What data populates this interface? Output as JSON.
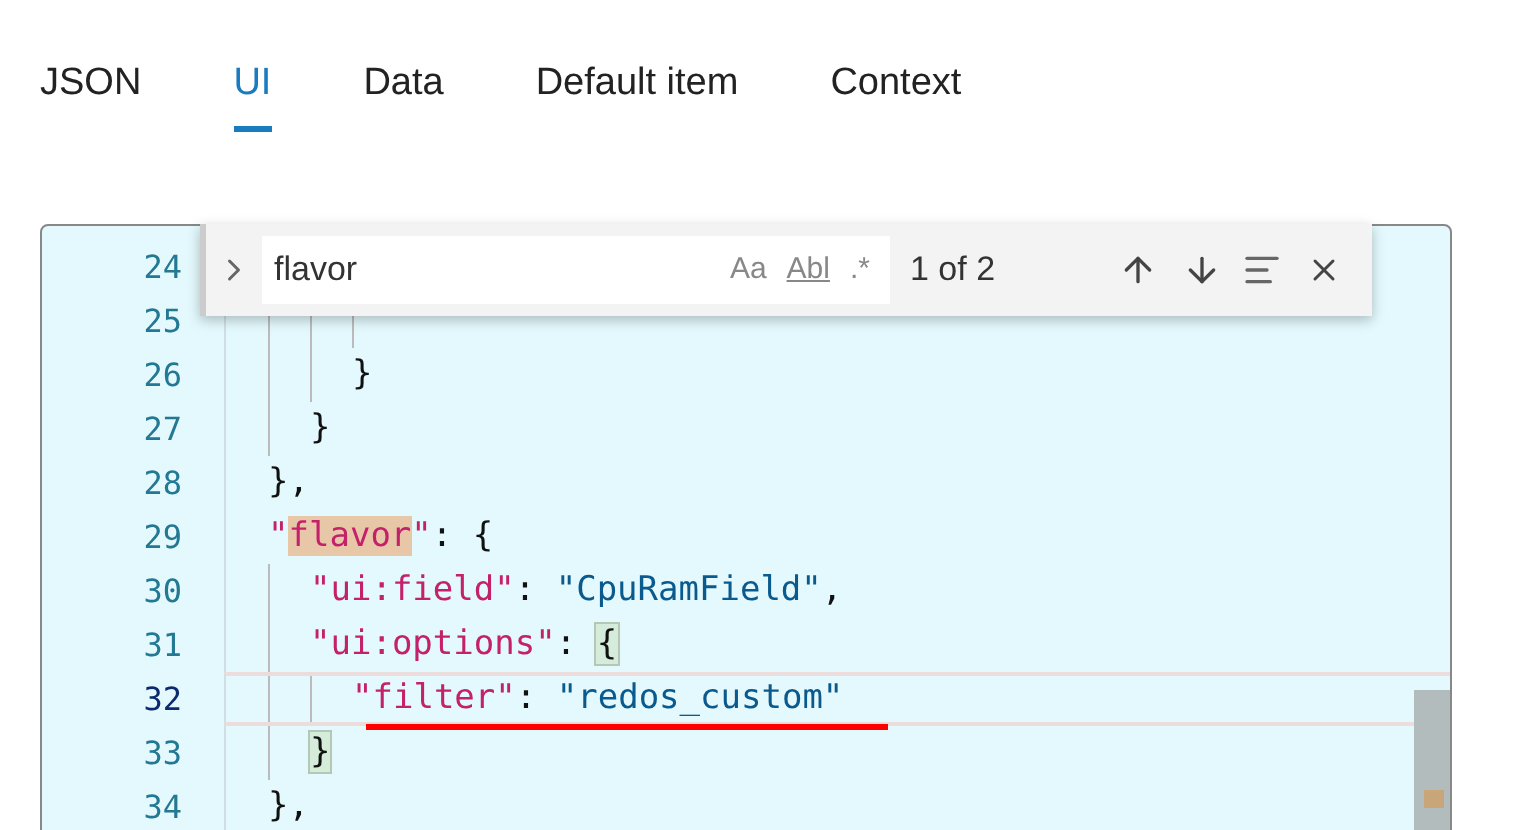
{
  "tabs": [
    {
      "label": "JSON",
      "selected": false
    },
    {
      "label": "UI",
      "selected": true
    },
    {
      "label": "Data",
      "selected": false
    },
    {
      "label": "Default item",
      "selected": false
    },
    {
      "label": "Context",
      "selected": false
    }
  ],
  "editor": {
    "lines": [
      {
        "number": "24",
        "current": false
      },
      {
        "children": [
          {
            "children": [
              {
                "children": [
                  {
                    "children": [
                      {
                        "number": "25",
                        "current": false
                      }
                    ]
                  },
                  {
                    "number": "26",
                    "current": false,
                    "tokens": [
                      {
                        "kind": "punct",
                        "text": "}"
                      }
                    ]
                  }
                ]
              },
              {
                "number": "27",
                "current": false,
                "tokens": [
                  {
                    "kind": "punct",
                    "text": "}"
                  }
                ]
              }
            ]
          },
          {
            "number": "28",
            "current": false,
            "tokens": [
              {
                "kind": "punct",
                "text": "},"
              }
            ]
          },
          {
            "number": "29",
            "current": false,
            "tokens": [
              {
                "kind": "key",
                "text": "\""
              },
              {
                "kind": "match",
                "text": "flavor"
              },
              {
                "kind": "key",
                "text": "\""
              },
              {
                "kind": "punct",
                "text": ": {"
              }
            ],
            "children": [
              {
                "number": "30",
                "current": false,
                "tokens": [
                  {
                    "kind": "key",
                    "text": "\"ui:field\""
                  },
                  {
                    "kind": "punct",
                    "text": ": "
                  },
                  {
                    "kind": "string",
                    "text": "\"CpuRamField\""
                  },
                  {
                    "kind": "punct",
                    "text": ","
                  }
                ]
              },
              {
                "number": "31",
                "current": false,
                "tokens": [
                  {
                    "kind": "key",
                    "text": "\"ui:options\""
                  },
                  {
                    "kind": "punct",
                    "text": ": "
                  },
                  {
                    "kind": "bracket",
                    "text": "{"
                  }
                ],
                "children": [
                  {
                    "number": "32",
                    "current": true,
                    "tokens": [
                      {
                        "kind": "key",
                        "text": "\"filter\""
                      },
                      {
                        "kind": "punct",
                        "text": ": "
                      },
                      {
                        "kind": "string",
                        "text": "\"redos_custom\""
                      }
                    ]
                  }
                ]
              },
              {
                "number": "33",
                "current": false,
                "tokens": [
                  {
                    "kind": "bracket",
                    "text": "}"
                  }
                ]
              }
            ]
          },
          {
            "number": "34",
            "current": false,
            "tokens": [
              {
                "kind": "punct",
                "text": "},"
              }
            ]
          }
        ]
      }
    ]
  },
  "find": {
    "value": "flavor",
    "options": [
      "Aa",
      "Abl",
      ".*"
    ],
    "count": "1 of 2"
  }
}
